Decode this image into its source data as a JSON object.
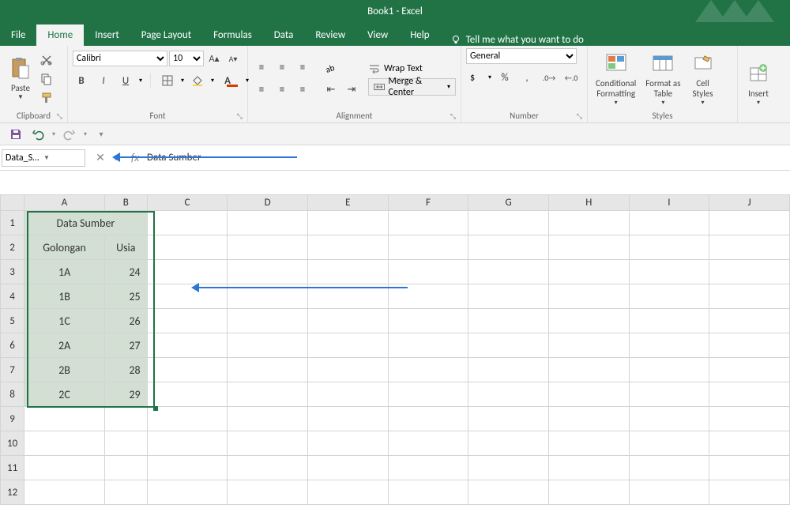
{
  "title": "Book1 - Excel",
  "tabs": {
    "file": "File",
    "home": "Home",
    "insert": "Insert",
    "page_layout": "Page Layout",
    "formulas": "Formulas",
    "data": "Data",
    "review": "Review",
    "view": "View",
    "help": "Help"
  },
  "tell_me": "Tell me what you want to do",
  "groups": {
    "clipboard": "Clipboard",
    "paste": "Paste",
    "font": "Font",
    "alignment": "Alignment",
    "number": "Number",
    "styles": "Styles",
    "insert_grp": "Insert"
  },
  "font": {
    "name": "Calibri",
    "size": "10"
  },
  "buttons": {
    "wrap_text": "Wrap Text",
    "merge_center": "Merge & Center",
    "number_format": "General",
    "cond_fmt": "Conditional\nFormatting",
    "fmt_table": "Format as\nTable",
    "cell_styles": "Cell\nStyles",
    "insert": "Insert"
  },
  "name_box": "Data_Sum...",
  "formula_value": "Data Sumber",
  "columns": [
    "A",
    "B",
    "C",
    "D",
    "E",
    "F",
    "G",
    "H",
    "I",
    "J"
  ],
  "rows": [
    "1",
    "2",
    "3",
    "4",
    "5",
    "6",
    "7",
    "8",
    "9",
    "10",
    "11",
    "12"
  ],
  "sheet": {
    "title": "Data Sumber",
    "headers": [
      "Golongan",
      "Usia"
    ],
    "data": [
      [
        "1A",
        24
      ],
      [
        "1B",
        25
      ],
      [
        "1C",
        26
      ],
      [
        "2A",
        27
      ],
      [
        "2B",
        28
      ],
      [
        "2C",
        29
      ]
    ]
  },
  "chart_data": {
    "type": "table",
    "title": "Data Sumber",
    "columns": [
      "Golongan",
      "Usia"
    ],
    "rows": [
      {
        "Golongan": "1A",
        "Usia": 24
      },
      {
        "Golongan": "1B",
        "Usia": 25
      },
      {
        "Golongan": "1C",
        "Usia": 26
      },
      {
        "Golongan": "2A",
        "Usia": 27
      },
      {
        "Golongan": "2B",
        "Usia": 28
      },
      {
        "Golongan": "2C",
        "Usia": 29
      }
    ]
  }
}
